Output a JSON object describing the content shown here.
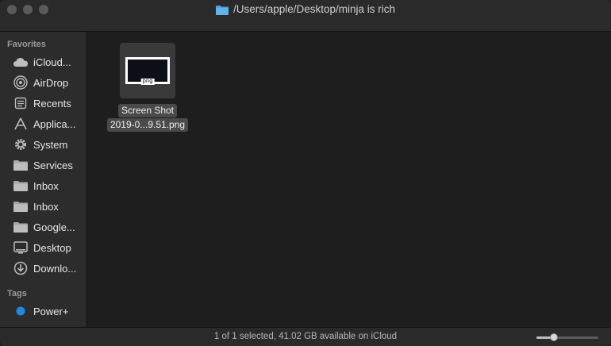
{
  "window": {
    "title": "/Users/apple/Desktop/minja is rich"
  },
  "sidebar": {
    "favorites_header": "Favorites",
    "favorites": [
      {
        "label": "iCloud...",
        "icon": "cloud-icon"
      },
      {
        "label": "AirDrop",
        "icon": "airdrop-icon"
      },
      {
        "label": "Recents",
        "icon": "recents-icon"
      },
      {
        "label": "Applica...",
        "icon": "applications-icon"
      },
      {
        "label": "System",
        "icon": "gear-icon"
      },
      {
        "label": "Services",
        "icon": "folder-icon"
      },
      {
        "label": "Inbox",
        "icon": "folder-icon"
      },
      {
        "label": "Inbox",
        "icon": "folder-icon"
      },
      {
        "label": "Google...",
        "icon": "folder-icon"
      },
      {
        "label": "Desktop",
        "icon": "desktop-icon"
      },
      {
        "label": "Downlo...",
        "icon": "downloads-icon"
      }
    ],
    "tags_header": "Tags",
    "tags": [
      {
        "label": "Power+",
        "color": "#1e88e5"
      }
    ]
  },
  "files": [
    {
      "name_line1": "Screen Shot",
      "name_line2": "2019-0...9.51.png",
      "badge": "png",
      "selected": true
    }
  ],
  "status": {
    "text": "1 of 1 selected, 41.02 GB available on iCloud",
    "zoom_level": 0.25
  },
  "colors": {
    "background": "#1e1e1e",
    "sidebar": "#2c2c2c",
    "tag_power": "#1e88e5"
  }
}
